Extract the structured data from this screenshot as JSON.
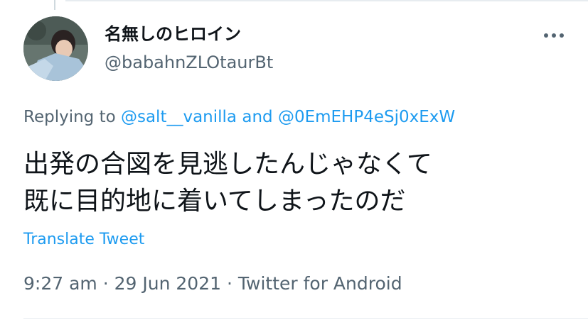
{
  "author": {
    "display_name": "名無しのヒロイン",
    "handle": "@babahnZLOtaurBt"
  },
  "reply": {
    "prefix": "Replying to",
    "mention_1": "@salt__vanilla",
    "conjunction": "and",
    "mention_2": "@0EmEHP4eSj0xExW"
  },
  "tweet": {
    "line_1": "出発の合図を見逃したんじゃなくて",
    "line_2": "既に目的地に着いてしまったのだ"
  },
  "translate_label": "Translate Tweet",
  "meta": {
    "time": "9:27 am",
    "separator_1": "·",
    "date": "29 Jun 2021",
    "separator_2": "·",
    "source": "Twitter for Android"
  },
  "icons": {
    "more": "more-horizontal-icon"
  },
  "colors": {
    "text_primary": "#0f1419",
    "text_secondary": "#536471",
    "link": "#1d9bf0",
    "divider": "#e7ecf0"
  }
}
